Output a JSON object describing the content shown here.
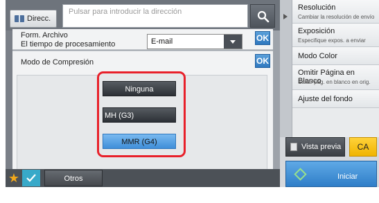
{
  "address": {
    "button_label": "Direcc.",
    "placeholder": "Pulsar para introducir la dirección"
  },
  "form_type": {
    "label_line1": "Form. Archivo",
    "label_line2": "El tiempo de procesamiento",
    "selected": "E-mail",
    "ok_label": "OK"
  },
  "compression": {
    "title": "Modo de Compresión",
    "ok_label": "OK",
    "options": [
      {
        "label": "Ninguna",
        "selected": false
      },
      {
        "label": "MH (G3)",
        "selected": false
      },
      {
        "label": "MMR (G4)",
        "selected": true
      }
    ]
  },
  "bottom": {
    "others_label": "Otros"
  },
  "side_menu": [
    {
      "title": "Resolución",
      "subtitle": "Cambiar la resolución de envío"
    },
    {
      "title": "Exposición",
      "subtitle": "Especifique expos. a enviar"
    },
    {
      "title": "Modo Color",
      "subtitle": ""
    },
    {
      "title": "Omitir Página en Blanco",
      "subtitle": "Saltar pág. en blanco en orig."
    },
    {
      "title": "Ajuste del fondo",
      "subtitle": ""
    }
  ],
  "actions": {
    "preview_label": "Vista previa",
    "ca_label": "CA",
    "start_label": "Iniciar"
  },
  "colors": {
    "highlight": "#e8202a",
    "selected_option": "#3f8fd9",
    "ca_button": "#f0b400",
    "start_button": "#2f7ec8"
  }
}
